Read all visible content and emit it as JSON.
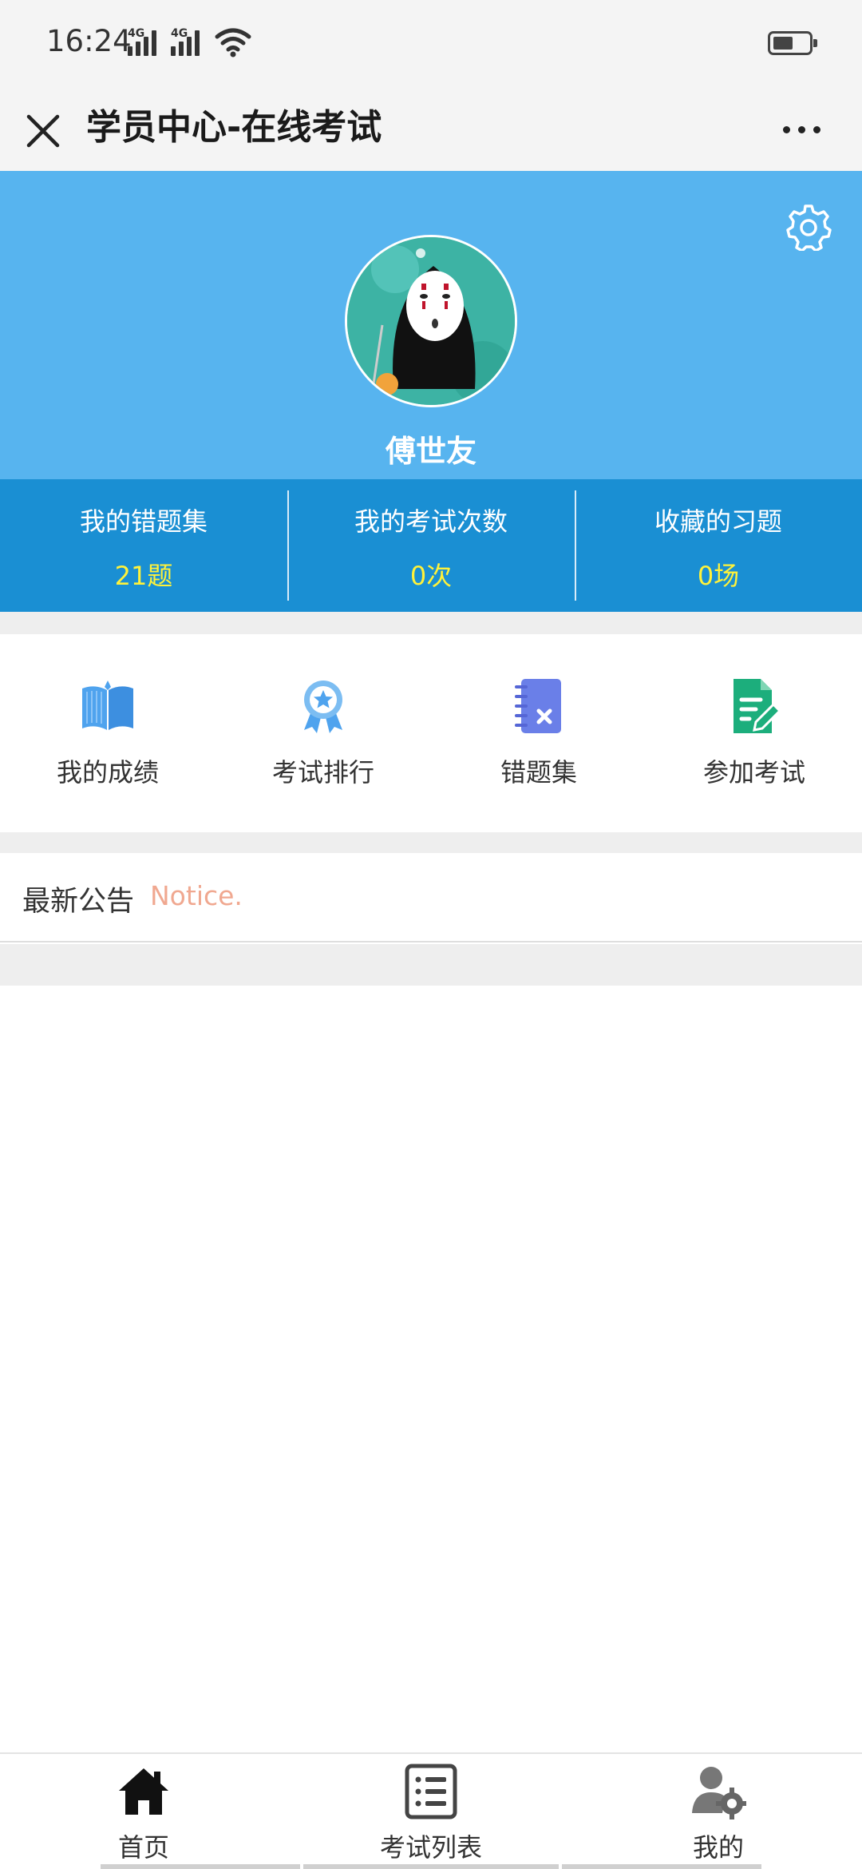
{
  "status_bar": {
    "time": "16:24",
    "signal_1": "4G",
    "signal_2": "4G",
    "icons": [
      "signal-icon",
      "signal-icon",
      "wifi-icon",
      "battery-icon"
    ]
  },
  "title_bar": {
    "title": "学员中心-在线考试",
    "close_icon": "close-icon",
    "more_icon": "more-icon"
  },
  "profile": {
    "name": "傅世友",
    "settings_icon": "gear-icon",
    "header_color": "#57b4ef"
  },
  "stats": [
    {
      "label": "我的错题集",
      "value": "21题"
    },
    {
      "label": "我的考试次数",
      "value": "0次"
    },
    {
      "label": "收藏的习题",
      "value": "0场"
    }
  ],
  "menu": [
    {
      "label": "我的成绩",
      "icon": "book-icon"
    },
    {
      "label": "考试排行",
      "icon": "ribbon-star-icon"
    },
    {
      "label": "错题集",
      "icon": "notebook-x-icon"
    },
    {
      "label": "参加考试",
      "icon": "document-pen-icon"
    }
  ],
  "notice": {
    "title": "最新公告",
    "subtitle": "Notice."
  },
  "bottom_nav": [
    {
      "label": "首页",
      "icon": "home-icon"
    },
    {
      "label": "考试列表",
      "icon": "list-icon"
    },
    {
      "label": "我的",
      "icon": "user-gear-icon"
    }
  ],
  "colors": {
    "accent": "#1a8fd3",
    "stat_value": "#fff23a",
    "notice_subtitle": "#f0a890"
  }
}
